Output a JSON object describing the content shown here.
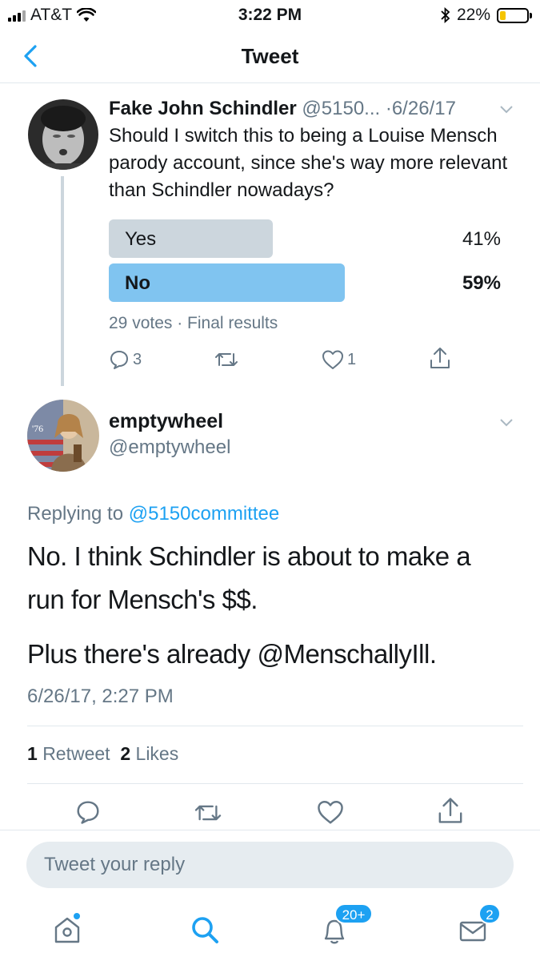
{
  "status_bar": {
    "carrier": "AT&T",
    "time": "3:22 PM",
    "battery_pct": "22%",
    "battery_level": 0.22
  },
  "nav": {
    "title": "Tweet"
  },
  "parent_tweet": {
    "author_name": "Fake John Schindler",
    "author_handle": "@5150...",
    "date": "·6/26/17",
    "text": "Should I switch this to being a Louise Mensch parody account, since she's way more relevant than Schindler nowadays?",
    "poll": {
      "options": [
        {
          "label": "Yes",
          "percent_text": "41%",
          "percent": 41
        },
        {
          "label": "No",
          "percent_text": "59%",
          "percent": 59
        }
      ],
      "meta": "29 votes · Final results"
    },
    "reply_count": "3",
    "like_count": "1"
  },
  "reply_tweet": {
    "author_name": "emptywheel",
    "author_handle": "@emptywheel",
    "replying_prefix": "Replying to",
    "replying_handle": "@5150committee",
    "text_line1": "No. I think Schindler is about to make a",
    "text_line2": "run for Mensch's $$.",
    "text_line3": "Plus there's already @MenschallyIll.",
    "timestamp": "6/26/17, 2:27 PM",
    "retweet_count": "1",
    "retweet_label": "Retweet",
    "like_count": "2",
    "like_label": "Likes"
  },
  "reply_box": {
    "placeholder": "Tweet your reply"
  },
  "tab_bar": {
    "notifications_badge": "20+",
    "messages_badge": "2"
  },
  "colors": {
    "accent": "#1da1f2",
    "poll_winner": "#80c4f0",
    "poll_loser": "#ccd6dd",
    "muted": "#657786"
  }
}
